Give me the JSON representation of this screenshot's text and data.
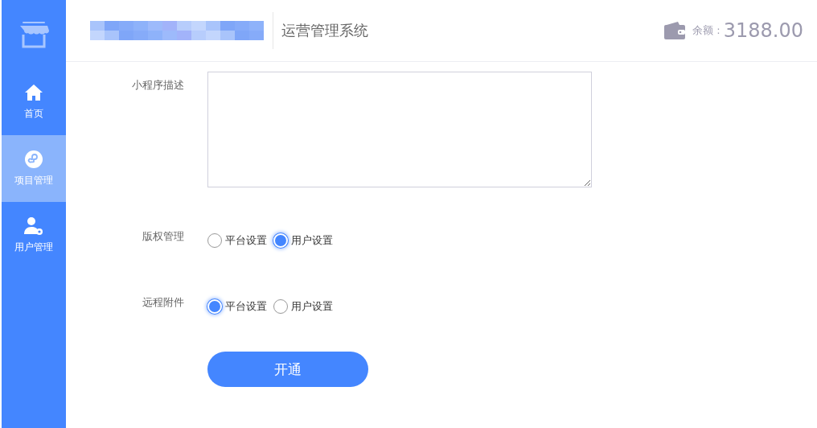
{
  "header": {
    "title": "运营管理系统",
    "balance_label": "余额 :",
    "balance": "3188.00"
  },
  "sidebar": {
    "items": [
      {
        "label": "首页",
        "kind": "home",
        "selected": false
      },
      {
        "label": "项目管理",
        "kind": "project",
        "selected": true
      },
      {
        "label": "用户管理",
        "kind": "user",
        "selected": false
      }
    ]
  },
  "form": {
    "description_label": "小程序描述",
    "radio_groups": [
      {
        "label": "版权管理",
        "options": [
          {
            "label": "平台设置",
            "selected": false
          },
          {
            "label": "用户设置",
            "selected": true
          }
        ]
      },
      {
        "label": "远程附件",
        "options": [
          {
            "label": "平台设置",
            "selected": true
          },
          {
            "label": "用户设置",
            "selected": false
          }
        ]
      }
    ],
    "submit": "开通"
  }
}
